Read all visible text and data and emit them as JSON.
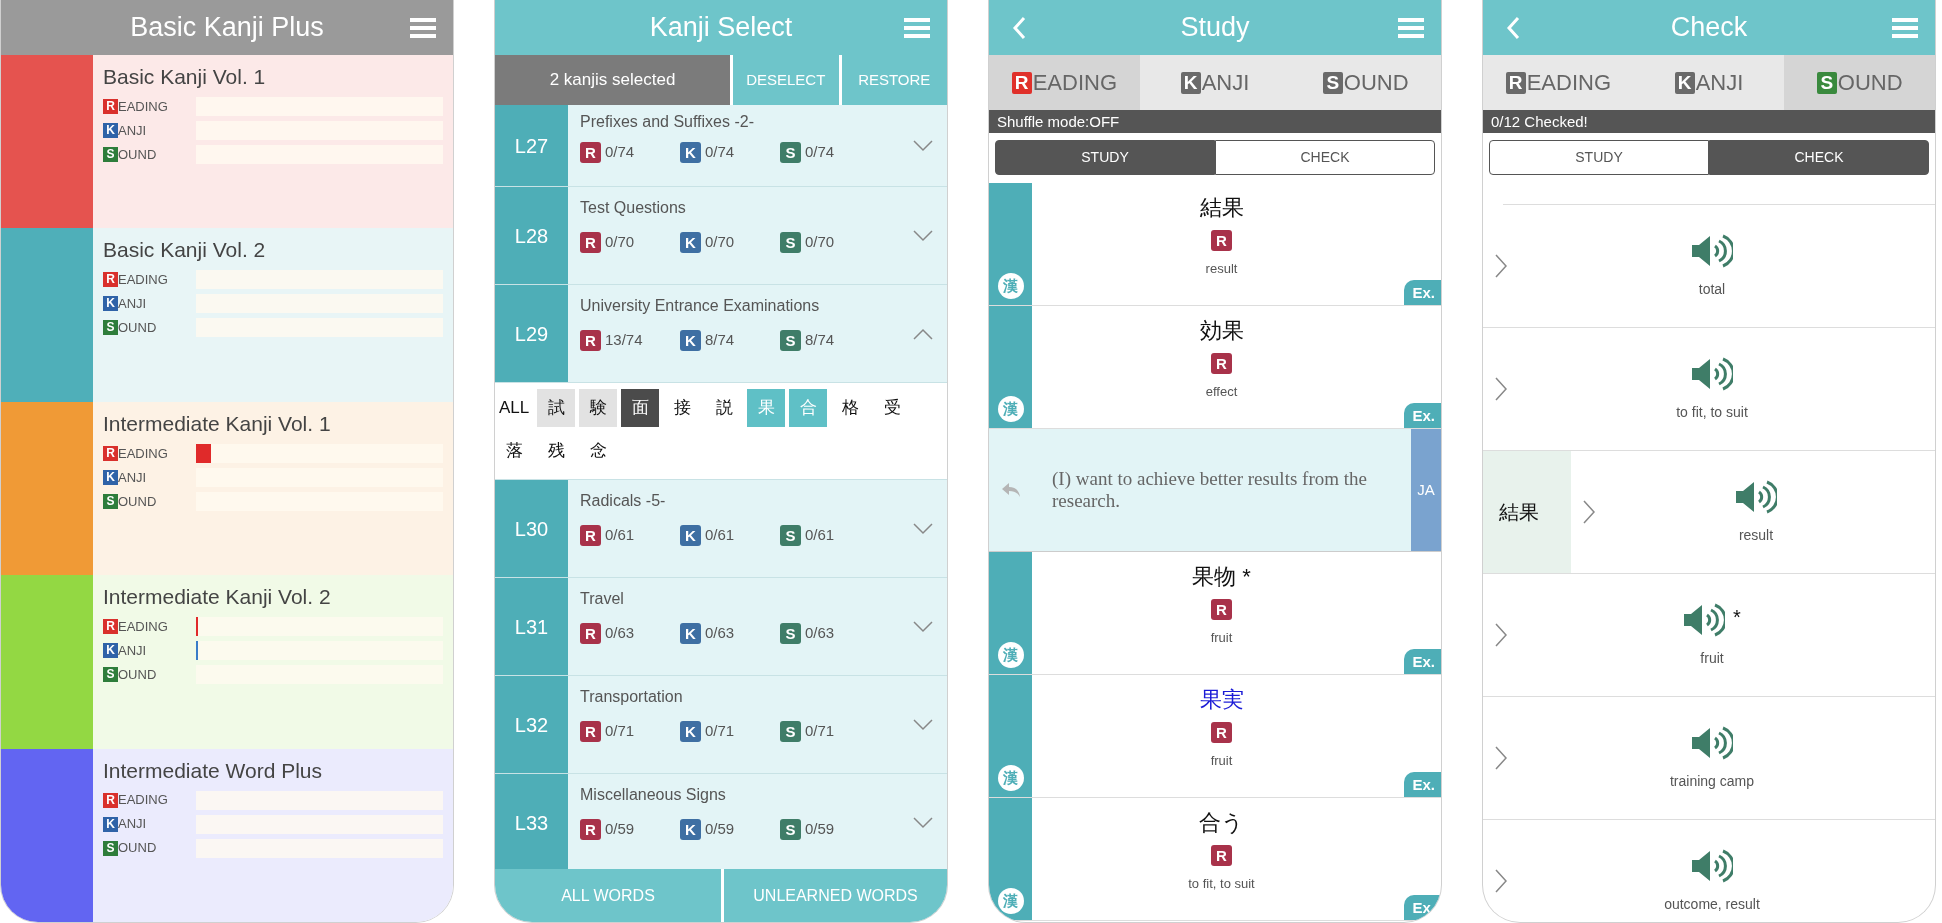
{
  "home": {
    "title": "Basic Kanji Plus",
    "books": [
      {
        "title": "Basic Kanji Vol. 1",
        "color": "#e5534f",
        "skills": [
          {
            "kind": "reading",
            "badge": "R",
            "label": "EADING",
            "level": 0
          },
          {
            "kind": "kanji",
            "badge": "K",
            "label": "ANJI",
            "level": 0
          },
          {
            "kind": "sound",
            "badge": "S",
            "label": "OUND",
            "level": 0
          }
        ]
      },
      {
        "title": "Basic Kanji Vol. 2",
        "color": "#4fafb9",
        "skills": [
          {
            "kind": "reading",
            "badge": "R",
            "label": "EADING",
            "level": 0
          },
          {
            "kind": "kanji",
            "badge": "K",
            "label": "ANJI",
            "level": 0
          },
          {
            "kind": "sound",
            "badge": "S",
            "label": "OUND",
            "level": 0
          }
        ]
      },
      {
        "title": "Intermediate Kanji Vol. 1",
        "color": "#f09a36",
        "skills": [
          {
            "kind": "reading",
            "badge": "R",
            "label": "EADING",
            "level": 0.06
          },
          {
            "kind": "kanji",
            "badge": "K",
            "label": "ANJI",
            "level": 0
          },
          {
            "kind": "sound",
            "badge": "S",
            "label": "OUND",
            "level": 0
          }
        ]
      },
      {
        "title": "Intermediate Kanji Vol. 2",
        "color": "#93d843",
        "skills": [
          {
            "kind": "reading",
            "badge": "R",
            "label": "EADING",
            "level": 0.005
          },
          {
            "kind": "kanji",
            "badge": "K",
            "label": "ANJI",
            "level": 0.005
          },
          {
            "kind": "sound",
            "badge": "S",
            "label": "OUND",
            "level": 0
          }
        ]
      },
      {
        "title": "Intermediate Word Plus",
        "color": "#6265f2",
        "skills": [
          {
            "kind": "reading",
            "badge": "R",
            "label": "EADING",
            "level": 0
          },
          {
            "kind": "kanji",
            "badge": "K",
            "label": "ANJI",
            "level": 0
          },
          {
            "kind": "sound",
            "badge": "S",
            "label": "OUND",
            "level": 0
          }
        ]
      }
    ]
  },
  "kanji_select": {
    "title": "Kanji Select",
    "selection": "2 kanjis selected",
    "actions": [
      "DESELECT",
      "RESTORE"
    ],
    "lessons": [
      {
        "number": "L27",
        "title": "Prefixes and Suffixes -2-",
        "expanded": false,
        "scores": [
          {
            "kind": "reading",
            "badge": "R",
            "value": "0/74"
          },
          {
            "kind": "kanji",
            "badge": "K",
            "value": "0/74"
          },
          {
            "kind": "sound",
            "badge": "S",
            "value": "0/74"
          }
        ]
      },
      {
        "number": "L28",
        "title": "Test Questions",
        "expanded": false,
        "scores": [
          {
            "kind": "reading",
            "badge": "R",
            "value": "0/70"
          },
          {
            "kind": "kanji",
            "badge": "K",
            "value": "0/70"
          },
          {
            "kind": "sound",
            "badge": "S",
            "value": "0/70"
          }
        ]
      },
      {
        "number": "L29",
        "title": "University Entrance Examinations",
        "expanded": true,
        "scores": [
          {
            "kind": "reading",
            "badge": "R",
            "value": "13/74"
          },
          {
            "kind": "kanji",
            "badge": "K",
            "value": "8/74"
          },
          {
            "kind": "sound",
            "badge": "S",
            "value": "8/74"
          }
        ],
        "kanji": [
          {
            "text": "ALL",
            "kind": "plain"
          },
          {
            "text": "試",
            "kind": "learned"
          },
          {
            "text": "験",
            "kind": "learned"
          },
          {
            "text": "面",
            "kind": "dark"
          },
          {
            "text": "接",
            "kind": "plain"
          },
          {
            "text": "説",
            "kind": "plain"
          },
          {
            "text": "果",
            "kind": "selected"
          },
          {
            "text": "合",
            "kind": "selected"
          },
          {
            "text": "格",
            "kind": "plain"
          },
          {
            "text": "受",
            "kind": "plain"
          },
          {
            "text": "落",
            "kind": "plain"
          },
          {
            "text": "残",
            "kind": "plain"
          },
          {
            "text": "念",
            "kind": "plain"
          }
        ]
      },
      {
        "number": "L30",
        "title": "Radicals -5-",
        "expanded": false,
        "scores": [
          {
            "kind": "reading",
            "badge": "R",
            "value": "0/61"
          },
          {
            "kind": "kanji",
            "badge": "K",
            "value": "0/61"
          },
          {
            "kind": "sound",
            "badge": "S",
            "value": "0/61"
          }
        ]
      },
      {
        "number": "L31",
        "title": "Travel",
        "expanded": false,
        "scores": [
          {
            "kind": "reading",
            "badge": "R",
            "value": "0/63"
          },
          {
            "kind": "kanji",
            "badge": "K",
            "value": "0/63"
          },
          {
            "kind": "sound",
            "badge": "S",
            "value": "0/63"
          }
        ]
      },
      {
        "number": "L32",
        "title": "Transportation",
        "expanded": false,
        "scores": [
          {
            "kind": "reading",
            "badge": "R",
            "value": "0/71"
          },
          {
            "kind": "kanji",
            "badge": "K",
            "value": "0/71"
          },
          {
            "kind": "sound",
            "badge": "S",
            "value": "0/71"
          }
        ]
      },
      {
        "number": "L33",
        "title": "Miscellaneous Signs",
        "expanded": false,
        "scores": [
          {
            "kind": "reading",
            "badge": "R",
            "value": "0/59"
          },
          {
            "kind": "kanji",
            "badge": "K",
            "value": "0/59"
          },
          {
            "kind": "sound",
            "badge": "S",
            "value": "0/59"
          }
        ]
      }
    ],
    "footer": [
      "ALL WORDS",
      "UNLEARNED WORDS"
    ]
  },
  "study": {
    "title": "Study",
    "tabs": [
      {
        "kind": "reading",
        "badge": "R",
        "label": "EADING",
        "selected": true
      },
      {
        "kind": "kanji",
        "badge": "K",
        "label": "ANJI",
        "selected": false
      },
      {
        "kind": "sound",
        "badge": "S",
        "label": "OUND",
        "selected": false
      }
    ],
    "status": "Shuffle mode:OFF",
    "modes": [
      {
        "label": "STUDY",
        "selected": true
      },
      {
        "label": "CHECK",
        "selected": false
      }
    ],
    "cards": [
      {
        "kind": "word",
        "word": "結果",
        "highlighted": false,
        "badge": "R",
        "meaning": "result",
        "mark": "漢",
        "example": "Ex."
      },
      {
        "kind": "word",
        "word": "効果",
        "highlighted": false,
        "badge": "R",
        "meaning": "effect",
        "mark": "漢",
        "example": "Ex."
      },
      {
        "kind": "sentence",
        "text": "(I) want to achieve better results from the research.",
        "lang": "JA"
      },
      {
        "kind": "word",
        "word": "果物 *",
        "highlighted": false,
        "badge": "R",
        "meaning": "fruit",
        "mark": "漢",
        "example": "Ex."
      },
      {
        "kind": "word",
        "word": "果実",
        "highlighted": true,
        "badge": "R",
        "meaning": "fruit",
        "mark": "漢",
        "example": "Ex."
      },
      {
        "kind": "word",
        "word": "合う",
        "highlighted": false,
        "badge": "R",
        "meaning": "to fit, to suit",
        "mark": "漢",
        "example": "Ex."
      }
    ]
  },
  "check": {
    "title": "Check",
    "tabs": [
      {
        "kind": "reading",
        "badge": "R",
        "label": "EADING",
        "selected": false
      },
      {
        "kind": "kanji",
        "badge": "K",
        "label": "ANJI",
        "selected": false
      },
      {
        "kind": "sound",
        "badge": "S",
        "label": "OUND",
        "selected": true
      }
    ],
    "status": "0/12 Checked!",
    "modes": [
      {
        "label": "STUDY",
        "selected": false
      },
      {
        "label": "CHECK",
        "selected": true
      }
    ],
    "items": [
      {
        "meaning": "total"
      },
      {
        "meaning": "to fit, to suit"
      },
      {
        "meaning": "result",
        "answer": "結果"
      },
      {
        "meaning": "fruit",
        "note": "*"
      },
      {
        "meaning": "training camp"
      },
      {
        "meaning": "outcome, result"
      }
    ]
  }
}
